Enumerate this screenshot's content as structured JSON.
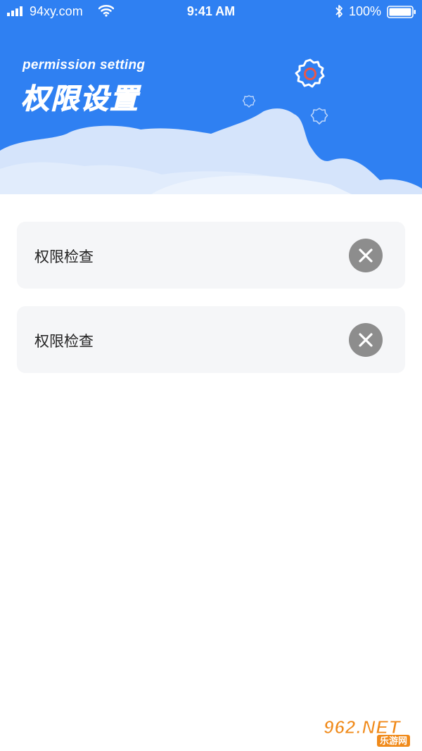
{
  "status_bar": {
    "carrier": "94xy.com",
    "time": "9:41 AM",
    "battery": "100%"
  },
  "header": {
    "subtitle": "permission setting",
    "title": "权限设置"
  },
  "list": {
    "items": [
      {
        "label": "权限检查"
      },
      {
        "label": "权限检查"
      }
    ]
  },
  "watermark": {
    "main": "962.NET",
    "sub": "乐游网"
  },
  "colors": {
    "header_blue": "#2f80f2",
    "cloud": "#d5e4fb",
    "card_bg": "#f5f6f8",
    "close_button": "#8d8d8d"
  },
  "icons": {
    "signal": "signal-icon",
    "wifi": "wifi-icon",
    "bluetooth": "bluetooth-icon",
    "battery": "battery-icon",
    "settings": "gear-icon",
    "remove": "close-icon"
  }
}
